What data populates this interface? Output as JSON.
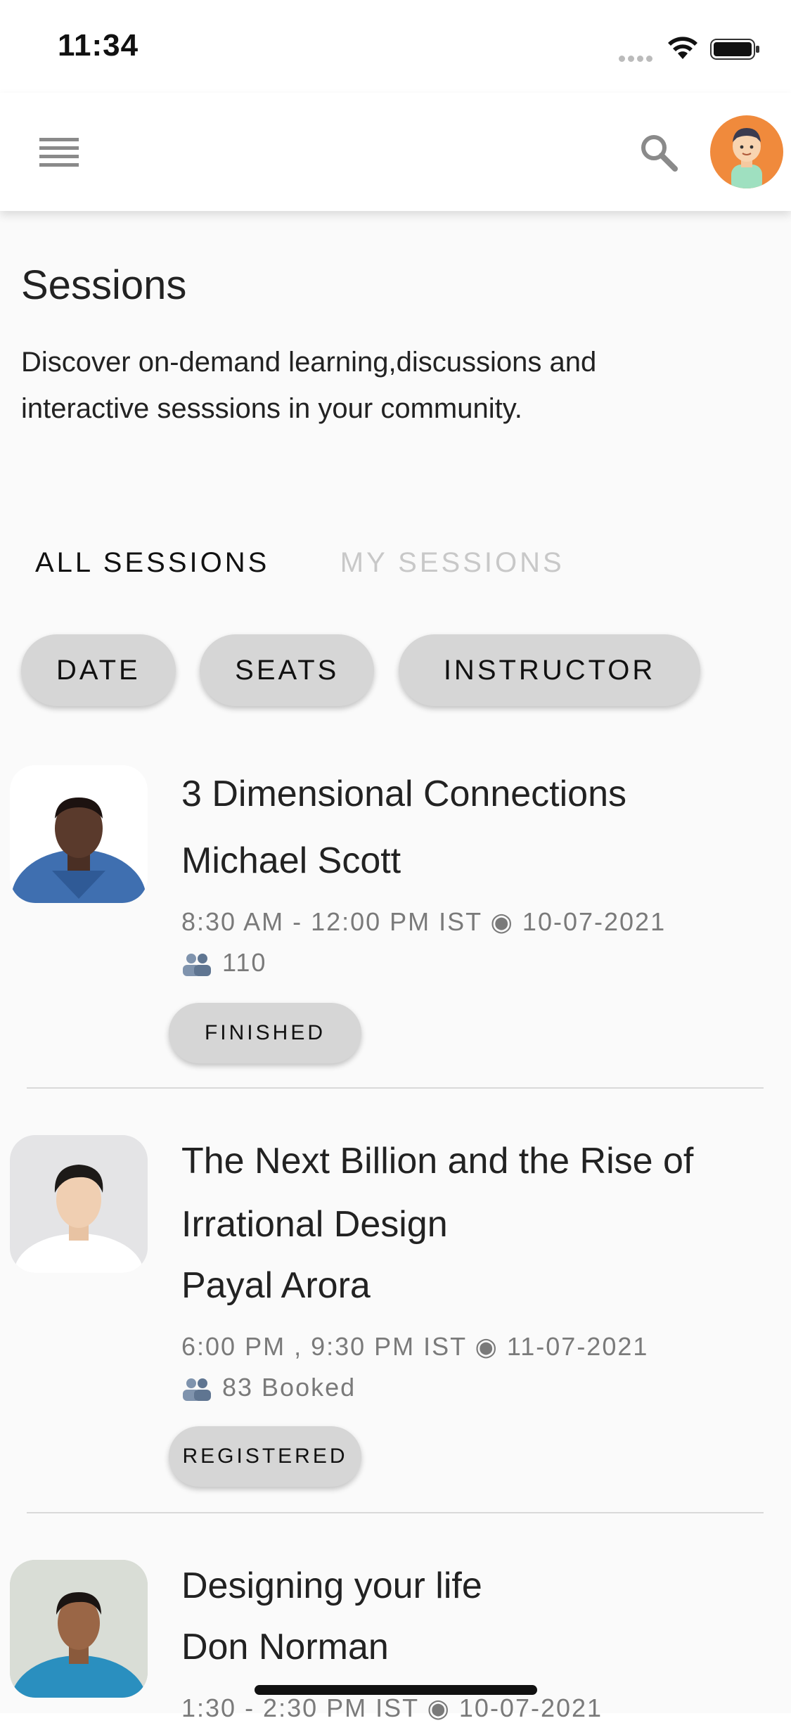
{
  "status_bar": {
    "time": "11:34"
  },
  "header": {
    "menu_icon": "menu-icon",
    "search_icon": "search-icon",
    "avatar": "avatar"
  },
  "page": {
    "title": "Sessions",
    "description": "Discover on-demand learning,discussions and interactive sesssions in your community."
  },
  "tabs": [
    {
      "label": "ALL SESSIONS",
      "active": true
    },
    {
      "label": "MY SESSIONS",
      "active": false
    }
  ],
  "filters": [
    "DATE",
    "SEATS",
    "INSTRUCTOR"
  ],
  "sessions": [
    {
      "title": "3 Dimensional Connections",
      "speaker": "Michael Scott",
      "time": "8:30 AM - 12:00 PM IST ◉ 10-07-2021",
      "seats": "110",
      "status": "FINISHED"
    },
    {
      "title": "The Next Billion and the Rise of Irrational Design",
      "speaker": "Payal Arora",
      "time": "6:00 PM , 9:30 PM IST ◉ 11-07-2021",
      "seats": "83 Booked",
      "status": "REGISTERED"
    },
    {
      "title": "Designing your life",
      "speaker": "Don Norman",
      "time": "1:30 - 2:30 PM IST ◉ 10-07-2021"
    }
  ]
}
